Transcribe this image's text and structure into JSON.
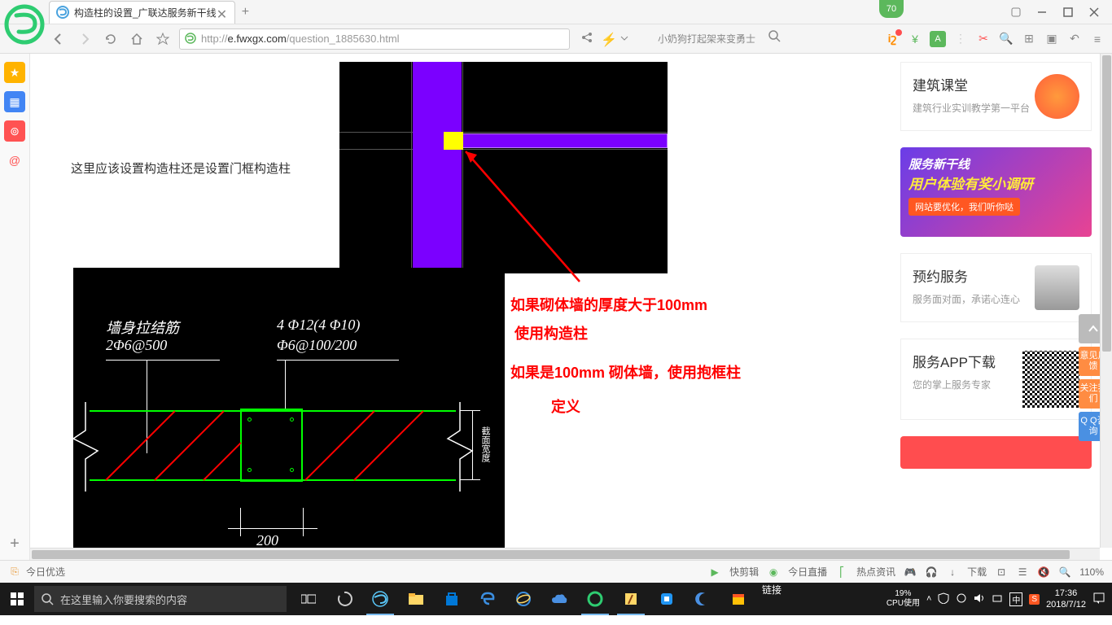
{
  "titlebar": {
    "tab_title": "构造柱的设置_广联达服务新干线",
    "score": "70"
  },
  "addressbar": {
    "url_prefix": "http://",
    "url_domain": "e.fwxgx.com",
    "url_path": "/question_1885630.html",
    "search_hint": "小奶狗打起架来变勇士"
  },
  "sidebar_left": {
    "items": [
      "★",
      "▦",
      "⊚",
      "@"
    ]
  },
  "article": {
    "question": "这里应该设置构造柱还是设置门框构造柱",
    "anno1": "如果砌体墙的厚度大于100mm",
    "anno2": "使用构造柱",
    "anno3": "如果是100mm 砌体墙，使用抱框柱",
    "anno4": "定义",
    "cad": {
      "label1a": "墙身拉结筋",
      "label1b": "2Φ6@500",
      "label2a": "4 Φ12(4 Φ10)",
      "label2b": "Φ6@100/200",
      "dim_w": "200",
      "side_txt": "截面宽度"
    }
  },
  "rightcol": {
    "card1_title": "建筑课堂",
    "card1_sub": "建筑行业实训教学第一平台",
    "banner_t1": "服务新干线",
    "banner_t2": "用户体验有奖小调研",
    "banner_t3": "网站要优化，我们听你哒",
    "card2_title": "预约服务",
    "card2_sub": "服务面对面，承诺心连心",
    "card3_title": "服务APP下载",
    "card3_sub": "您的掌上服务专家",
    "float_feedback": "意见反馈",
    "float_follow": "关注我们",
    "float_qq": "Q Q咨询"
  },
  "statusbar": {
    "today": "今日优选",
    "clip": "快剪辑",
    "live": "今日直播",
    "hot": "热点资讯",
    "download": "下载",
    "zoom": "110%"
  },
  "taskbar": {
    "search_placeholder": "在这里输入你要搜索的内容",
    "link": "链接",
    "cpu_pct": "19%",
    "cpu_lbl": "CPU使用",
    "time": "17:36",
    "date": "2018/7/12"
  }
}
